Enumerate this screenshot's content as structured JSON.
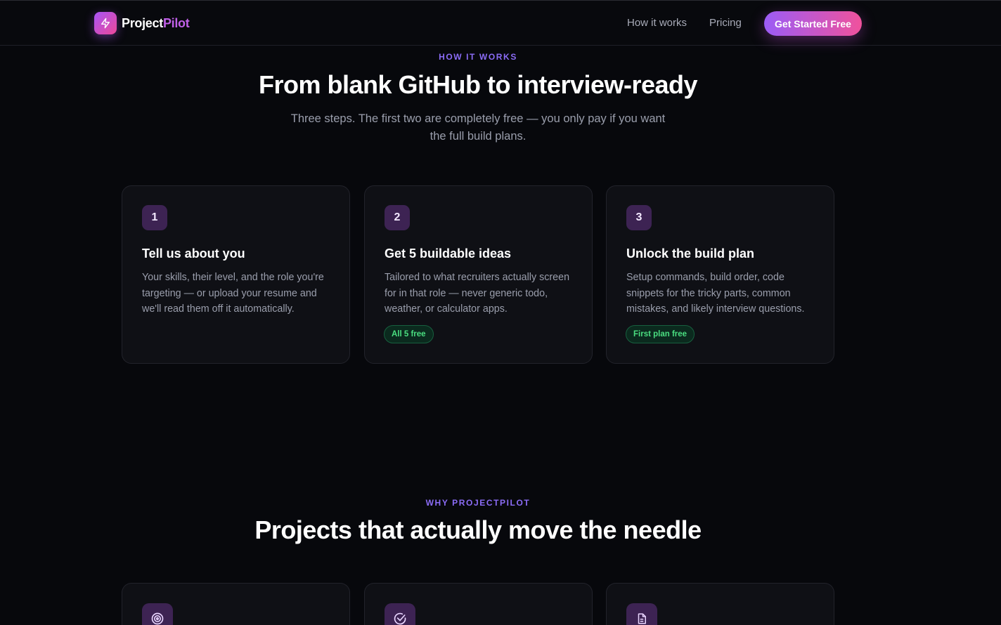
{
  "nav": {
    "logo_part1": "Project",
    "logo_part2": "Pilot",
    "links": [
      "How it works",
      "Pricing"
    ],
    "cta_label": "Get Started Free"
  },
  "how_it_works": {
    "eyebrow": "HOW IT WORKS",
    "title": "From blank GitHub to interview-ready",
    "subtitle": "Three steps. The first two are completely free — you only pay if you want the full build plans.",
    "steps": [
      {
        "number": "1",
        "title": "Tell us about you",
        "description": "Your skills, their level, and the role you're targeting — or upload your resume and we'll read them off it automatically."
      },
      {
        "number": "2",
        "title": "Get 5 buildable ideas",
        "description": "Tailored to what recruiters actually screen for in that role — never generic todo, weather, or calculator apps.",
        "badge": "All 5 free"
      },
      {
        "number": "3",
        "title": "Unlock the build plan",
        "description": "Setup commands, build order, code snippets for the tricky parts, common mistakes, and likely interview questions.",
        "badge": "First plan free"
      }
    ]
  },
  "why": {
    "eyebrow": "WHY PROJECTPILOT",
    "title": "Projects that actually move the needle",
    "feature_icons": [
      "target-icon",
      "check-circle-icon",
      "document-icon"
    ]
  },
  "colors": {
    "background": "#07080c",
    "accent_purple": "#8b6cf6",
    "accent_pink": "#ec4899",
    "badge_green": "#4ade80"
  }
}
